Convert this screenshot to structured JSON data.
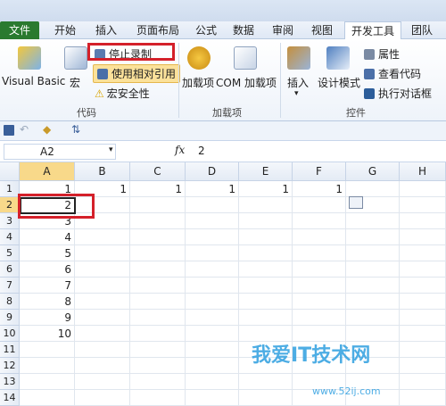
{
  "ribbon_tabs": [
    "文件",
    "开始",
    "插入",
    "页面布局",
    "公式",
    "数据",
    "审阅",
    "视图",
    "开发工具",
    "团队"
  ],
  "active_tab": "开发工具",
  "code_group": {
    "visual_basic": "Visual Basic",
    "macros": "宏",
    "stop_recording": "停止录制",
    "relative_refs": "使用相对引用",
    "macro_security": "宏安全性",
    "label": "代码"
  },
  "addins_group": {
    "addins": "加载项",
    "com_addins": "COM 加载项",
    "label": "加载项"
  },
  "controls_group": {
    "insert": "插入",
    "design_mode": "设计模式",
    "properties": "属性",
    "view_code": "查看代码",
    "run_dialog": "执行对话框",
    "label": "控件"
  },
  "formula_bar": {
    "name_box": "A2",
    "fx": "fx",
    "value": "2"
  },
  "columns": [
    "A",
    "B",
    "C",
    "D",
    "E",
    "F",
    "G",
    "H"
  ],
  "rows": [
    "1",
    "2",
    "3",
    "4",
    "5",
    "6",
    "7",
    "8",
    "9",
    "10",
    "11",
    "12",
    "13",
    "14"
  ],
  "row1_values": [
    "1",
    "1",
    "1",
    "1",
    "1",
    "1"
  ],
  "col_a_values": [
    "1",
    "2",
    "3",
    "4",
    "5",
    "6",
    "7",
    "8",
    "9",
    "10"
  ],
  "watermark": {
    "main": "我爱IT技术网",
    "sub": "www.52ij.com"
  },
  "colors": {
    "file_tab": "#2a7a2f",
    "highlight": "#fbe19a",
    "red_box": "#d4202a",
    "selected_header": "#f8d98a"
  }
}
